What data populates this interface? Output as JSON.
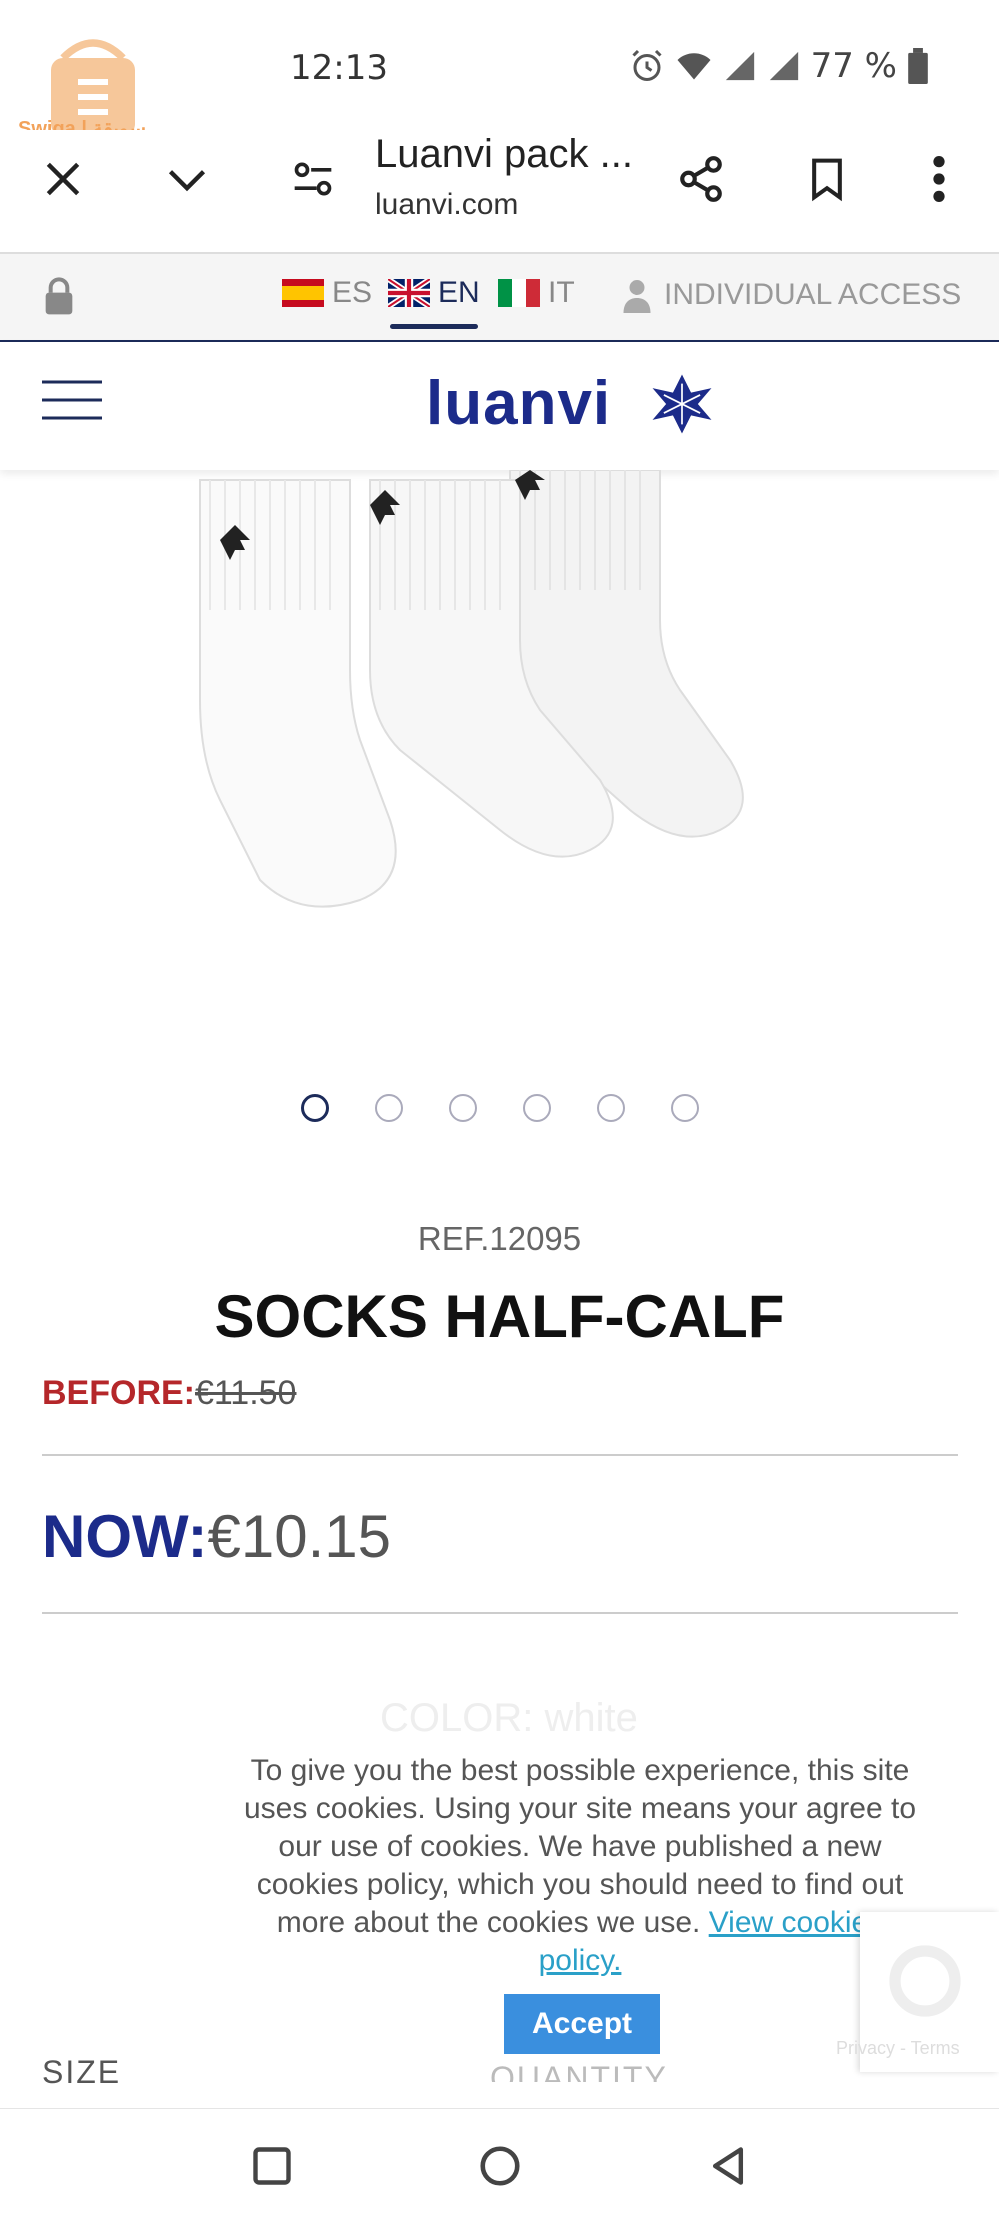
{
  "status_bar": {
    "time": "12:13",
    "battery": "77 %"
  },
  "watermark": {
    "text": "Swiga | سويقة"
  },
  "browser": {
    "title": "Luanvi pack ...",
    "domain": "luanvi.com"
  },
  "site_bar": {
    "languages": [
      {
        "code": "ES",
        "active": false
      },
      {
        "code": "EN",
        "active": true
      },
      {
        "code": "IT",
        "active": false
      }
    ],
    "individual_access": "INDIVIDUAL ACCESS"
  },
  "header": {
    "brand": "luanvi"
  },
  "gallery": {
    "total": 6,
    "active_index": 0
  },
  "product": {
    "ref": "REF.12095",
    "title": "SOCKS HALF-CALF",
    "before_label": "BEFORE:",
    "before_price": "€11.50",
    "now_label": "NOW:",
    "now_price": "€10.15",
    "faded_label": "COLOR: white",
    "size_label": "SIZE",
    "quantity_label": "QUANTITY"
  },
  "cookie": {
    "text": "To give you the best possible experience, this site uses cookies. Using your site means your agree to our use of cookies. We have published a new cookies policy, which you should need to find out more about the cookies we use.",
    "link": "View cookies policy.",
    "accept": "Accept"
  },
  "recaptcha": {
    "text": "Privacy - Terms"
  },
  "colors": {
    "brand": "#1c2b8a",
    "sale_red": "#b5272a",
    "accept_blue": "#3a8fde",
    "link": "#2aa0c8"
  }
}
